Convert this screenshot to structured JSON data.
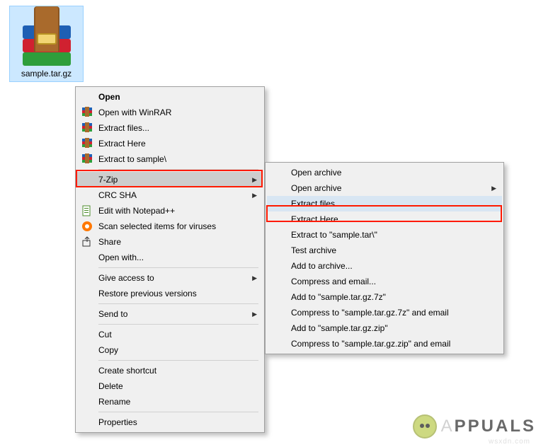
{
  "file": {
    "name": "sample.tar.gz"
  },
  "menu_main": {
    "open": "Open",
    "open_with_winrar": "Open with WinRAR",
    "extract_files": "Extract files...",
    "extract_here": "Extract Here",
    "extract_to_folder": "Extract to sample\\",
    "seven_zip": "7-Zip",
    "crc_sha": "CRC SHA",
    "edit_notepadpp": "Edit with Notepad++",
    "scan_viruses": "Scan selected items for viruses",
    "share": "Share",
    "open_with": "Open with...",
    "give_access_to": "Give access to",
    "restore_previous": "Restore previous versions",
    "send_to": "Send to",
    "cut": "Cut",
    "copy": "Copy",
    "create_shortcut": "Create shortcut",
    "delete": "Delete",
    "rename": "Rename",
    "properties": "Properties"
  },
  "menu_sub": {
    "open_archive": "Open archive",
    "open_archive2": "Open archive",
    "extract_files": "Extract files...",
    "extract_here": "Extract Here",
    "extract_to": "Extract to \"sample.tar\\\"",
    "test_archive": "Test archive",
    "add_to_archive": "Add to archive...",
    "compress_email": "Compress and email...",
    "add_to_7z": "Add to \"sample.tar.gz.7z\"",
    "compress_7z_email": "Compress to \"sample.tar.gz.7z\" and email",
    "add_to_zip": "Add to \"sample.tar.gz.zip\"",
    "compress_zip_email": "Compress to \"sample.tar.gz.zip\" and email"
  },
  "brand": {
    "text": "PPUALS",
    "prefix_letter": "A"
  },
  "watermark_url": "wsxdn.com"
}
